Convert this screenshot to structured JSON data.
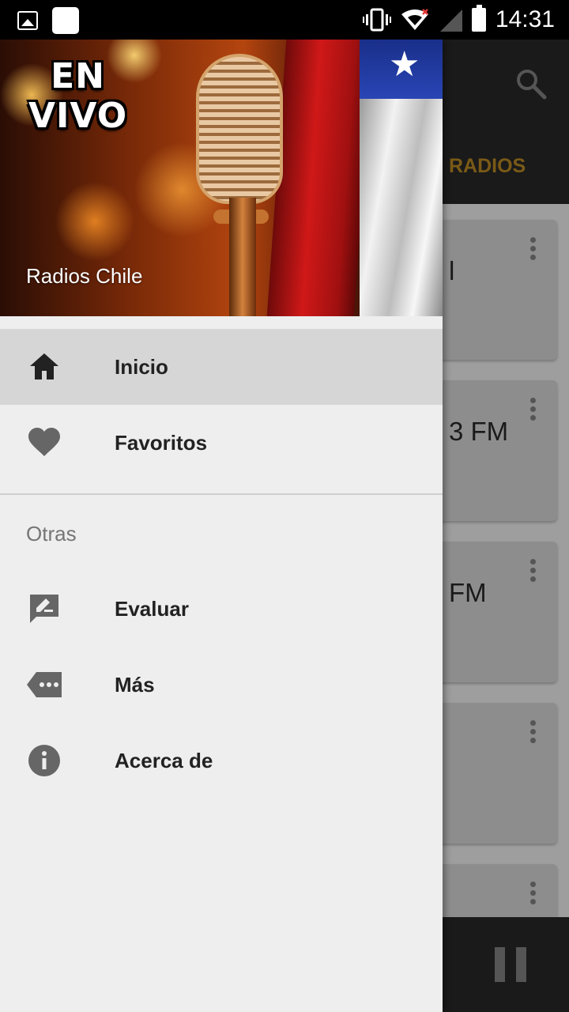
{
  "status_bar": {
    "time": "14:31",
    "icons": [
      "gallery-icon",
      "notification-icon",
      "vibrate-icon",
      "wifi-icon",
      "signal-icon",
      "battery-icon"
    ]
  },
  "background_app": {
    "tab_label": "RADIOS",
    "cards": [
      {
        "title": "l"
      },
      {
        "title": "3 FM"
      },
      {
        "title": "FM"
      },
      {
        "title": ""
      },
      {
        "title": ""
      }
    ],
    "colors": {
      "toolbar": "#1a1a1a",
      "tab_accent": "#7a5a17"
    }
  },
  "drawer": {
    "header": {
      "badge_line1": "EN",
      "badge_line2": "VIVO",
      "title": "Radios Chile"
    },
    "primary_items": [
      {
        "label": "Inicio",
        "icon": "home-icon",
        "active": true
      },
      {
        "label": "Favoritos",
        "icon": "heart-icon",
        "active": false
      }
    ],
    "section_label": "Otras",
    "secondary_items": [
      {
        "label": "Evaluar",
        "icon": "rate-review-icon"
      },
      {
        "label": "Más",
        "icon": "more-label-icon"
      },
      {
        "label": "Acerca de",
        "icon": "info-icon"
      }
    ],
    "colors": {
      "background": "#eeeeee",
      "active_row": "#d6d6d6"
    }
  }
}
